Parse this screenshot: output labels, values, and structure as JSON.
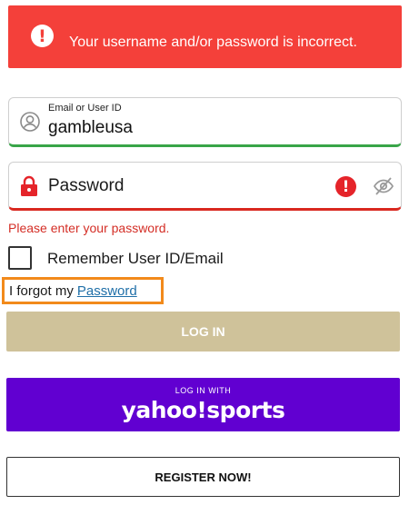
{
  "error_banner": {
    "message": "Your username and/or password is incorrect.",
    "icon": "exclamation-circle-icon",
    "color": "#f4403a"
  },
  "email_field": {
    "label": "Email or User ID",
    "value": "gambleusa",
    "icon": "user-icon",
    "status_color": "#38a548"
  },
  "password_field": {
    "placeholder": "Password",
    "value": "",
    "icon": "lock-icon",
    "status_color": "#d9281f",
    "error_icon": "exclamation-circle-icon",
    "toggle_icon": "eye-slash-icon"
  },
  "password_error": "Please enter your password.",
  "remember": {
    "label": "Remember User ID/Email",
    "checked": false
  },
  "forgot": {
    "text": "I forgot my",
    "link_text": "Password",
    "highlight_color": "#f28a1b"
  },
  "buttons": {
    "login": "LOG IN",
    "yahoo_prefix": "LOG IN WITH",
    "yahoo_brand": "yahoo!sports",
    "register": "REGISTER NOW!"
  },
  "colors": {
    "login_button": "#cfc29a",
    "yahoo_button": "#6100d1",
    "link": "#1f6fa8"
  }
}
